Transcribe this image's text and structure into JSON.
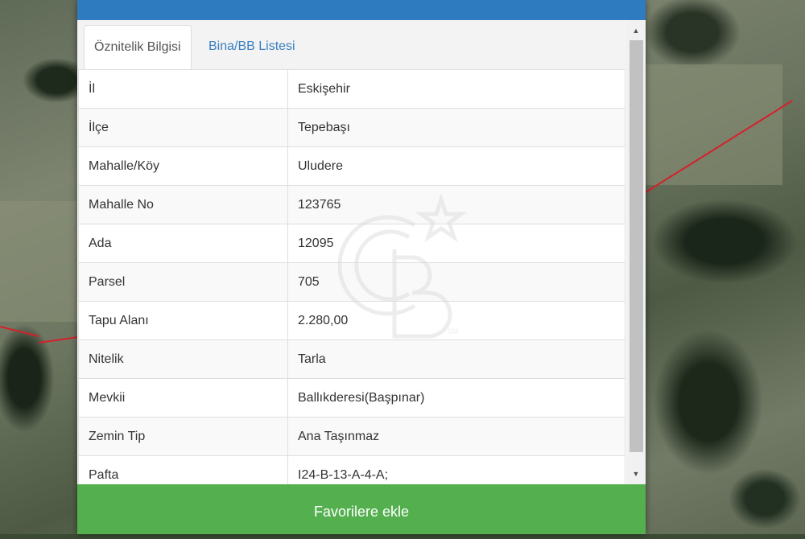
{
  "tabs": [
    {
      "label": "Öznitelik Bilgisi",
      "active": true
    },
    {
      "label": "Bina/BB Listesi",
      "active": false
    }
  ],
  "attributes": [
    {
      "key": "İl",
      "value": "Eskişehir"
    },
    {
      "key": "İlçe",
      "value": "Tepebaşı"
    },
    {
      "key": "Mahalle/Köy",
      "value": "Uludere"
    },
    {
      "key": "Mahalle No",
      "value": "123765"
    },
    {
      "key": "Ada",
      "value": "12095"
    },
    {
      "key": "Parsel",
      "value": "705"
    },
    {
      "key": "Tapu Alanı",
      "value": "2.280,00"
    },
    {
      "key": "Nitelik",
      "value": "Tarla"
    },
    {
      "key": "Mevkii",
      "value": "Ballıkderesi(Başpınar)"
    },
    {
      "key": "Zemin Tip",
      "value": "Ana Taşınmaz"
    },
    {
      "key": "Pafta",
      "value": "I24-B-13-A-4-A;"
    }
  ],
  "actions": {
    "favorite_label": "Favorilere ekle"
  },
  "watermark": {
    "text": "CB",
    "mark": "SM"
  },
  "colors": {
    "header": "#2f7bbf",
    "favorite_button": "#54b04f",
    "tab_link": "#3a7fc0",
    "parcel_line": "#d4212b"
  }
}
